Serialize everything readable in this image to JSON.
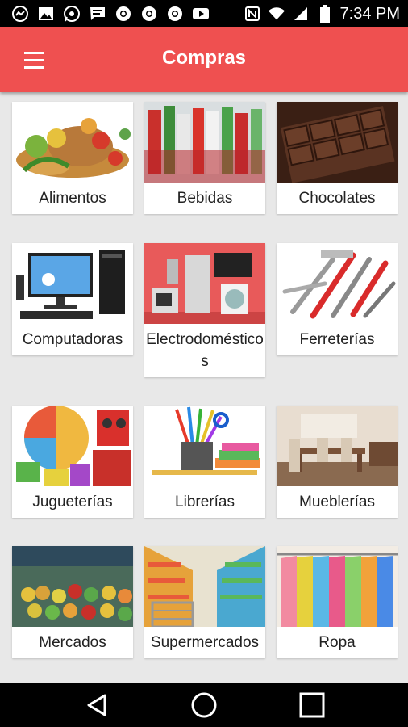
{
  "status_bar": {
    "time": "7:34 PM",
    "icons_left": [
      "messenger-icon",
      "gallery-icon",
      "whatsapp-icon",
      "message-icon",
      "chrome-icon",
      "chrome-icon",
      "chrome-icon",
      "youtube-icon"
    ],
    "icons_right": [
      "nfc-icon",
      "wifi-icon",
      "signal-icon",
      "battery-icon"
    ]
  },
  "app_bar": {
    "title": "Compras",
    "menu_icon": "menu-icon",
    "color": "#ef5050"
  },
  "categories": [
    {
      "label": "Alimentos",
      "image": "food-image"
    },
    {
      "label": "Bebidas",
      "image": "drinks-image"
    },
    {
      "label": "Chocolates",
      "image": "chocolate-image"
    },
    {
      "label": "Computadoras",
      "image": "computer-image"
    },
    {
      "label": "Electrodomésticos",
      "image": "appliances-image"
    },
    {
      "label": "Ferreterías",
      "image": "tools-image"
    },
    {
      "label": "Jugueterías",
      "image": "toys-image"
    },
    {
      "label": "Librerías",
      "image": "stationery-image"
    },
    {
      "label": "Mueblerías",
      "image": "furniture-image"
    },
    {
      "label": "Mercados",
      "image": "market-image"
    },
    {
      "label": "Supermercados",
      "image": "supermarket-image"
    },
    {
      "label": "Ropa",
      "image": "clothes-image"
    }
  ],
  "nav_bar": {
    "back": "back-icon",
    "home": "home-icon",
    "recents": "recents-icon"
  }
}
